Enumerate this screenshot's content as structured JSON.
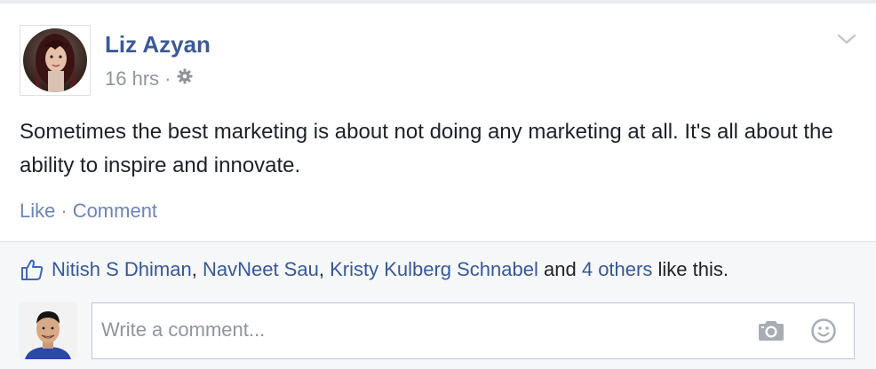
{
  "post": {
    "author": "Liz Azyan",
    "timestamp": "16 hrs",
    "meta_separator": "·",
    "text": "Sometimes the best marketing is about not doing any marketing at all. It's all about the ability to inspire and innovate.",
    "actions": {
      "like_label": "Like",
      "separator": "·",
      "comment_label": "Comment"
    }
  },
  "likes": {
    "people": [
      "Nitish S Dhiman",
      "NavNeet Sau",
      "Kristy Kulberg Schnabel"
    ],
    "separator": ",",
    "conjunction": "and",
    "others_label": "4 others",
    "suffix": "like this."
  },
  "comment_input": {
    "placeholder": "Write a comment..."
  },
  "icons": {
    "privacy": "gear-icon",
    "post_menu": "chevron-down-icon",
    "like_thumb": "thumbs-up-icon",
    "photo": "camera-icon",
    "sticker": "smiley-icon"
  },
  "colors": {
    "link_blue": "#3b5998",
    "meta_gray": "#90949c",
    "text_dark": "#1d2129",
    "feedback_bg": "#f6f7f9"
  }
}
